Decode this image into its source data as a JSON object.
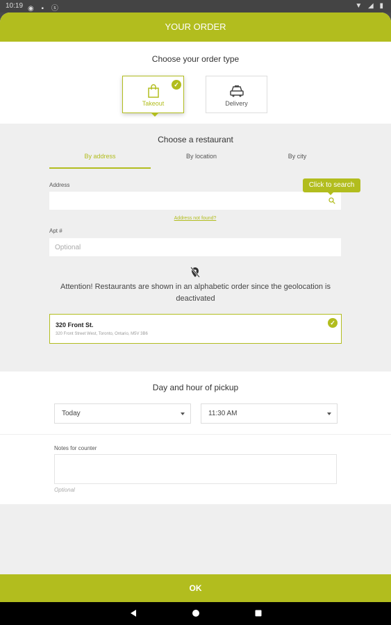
{
  "status_bar": {
    "time": "10:19"
  },
  "header": {
    "title": "YOUR ORDER"
  },
  "order_type": {
    "title": "Choose your order type",
    "options": [
      {
        "label": "Takeout",
        "icon": "shopping-bag-icon",
        "selected": true
      },
      {
        "label": "Delivery",
        "icon": "car-icon",
        "selected": false
      }
    ]
  },
  "restaurant": {
    "title": "Choose a restaurant",
    "tabs": [
      {
        "label": "By address",
        "active": true
      },
      {
        "label": "By location",
        "active": false
      },
      {
        "label": "By city",
        "active": false
      }
    ],
    "address_label": "Address",
    "address_value": "",
    "search_tooltip": "Click to search",
    "address_not_found": "Address not found?",
    "apt_label": "Apt #",
    "apt_placeholder": "Optional",
    "attention": "Attention! Restaurants are shown in an alphabetic order since the geolocation is deactivated",
    "selected_restaurant": {
      "name": "320 Front St.",
      "address": "320 Front Street West, Toronto, Ontario, M5V 3B6"
    }
  },
  "pickup": {
    "title": "Day and hour of pickup",
    "day": "Today",
    "hour": "11:30 AM"
  },
  "notes": {
    "label": "Notes for counter",
    "hint": "Optional"
  },
  "ok_label": "OK",
  "colors": {
    "accent": "#b2bd1e",
    "background": "#efefef"
  }
}
